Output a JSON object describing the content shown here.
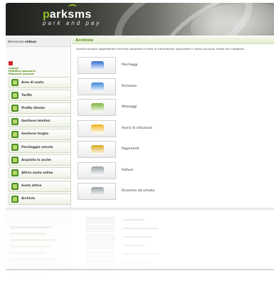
{
  "header": {
    "logo_p": "p",
    "logo_rest": "arksms",
    "tagline": "park and pay"
  },
  "sidebar": {
    "welcome_prefix": "Benvenuto ",
    "welcome_user": "nidiusr",
    "links": [
      "Logout",
      "Modifica password",
      "Riassumi account"
    ],
    "menu": [
      {
        "label": "Aree di sosta",
        "icon": "parking-area-icon"
      },
      {
        "label": "Tariffe",
        "icon": "tariff-icon"
      },
      {
        "label": "Profilo Utente",
        "icon": "user-profile-icon"
      },
      {
        "label": "Gestione telefoni",
        "icon": "phone-icon"
      },
      {
        "label": "Gestione targhe",
        "icon": "car-plate-icon"
      },
      {
        "label": "Parcheggia veicolo",
        "icon": "park-vehicle-icon"
      },
      {
        "label": "Acquista in anche",
        "icon": "cart-icon"
      },
      {
        "label": "Attiva sosta online",
        "icon": "activate-parking-icon"
      },
      {
        "label": "Sosta attive",
        "icon": "active-parking-icon"
      },
      {
        "label": "Archivio",
        "icon": "archive-folder-icon"
      }
    ]
  },
  "main": {
    "title": "Archivio",
    "intro": "Questa sezione rappresenta l'archivio completo di tutte le informazioni riguardanti il vostro account, divise per categoria.",
    "rows": [
      {
        "label": "Parcheggi",
        "icon": "car-icon",
        "color": "#2f6fd1"
      },
      {
        "label": "Richieste",
        "icon": "mobile-phone-icon",
        "color": "#3a88d8"
      },
      {
        "label": "Messaggi",
        "icon": "message-icon",
        "color": "#7fb33a"
      },
      {
        "label": "Avvisi di infrazione",
        "icon": "shield-warning-icon",
        "color": "#f0b21d"
      },
      {
        "label": "Pagamenti",
        "icon": "coins-icon",
        "color": "#d9a919"
      },
      {
        "label": "Fatture",
        "icon": "invoice-icon",
        "color": "#9aa3a6"
      },
      {
        "label": "Ricariche da scheda",
        "icon": "recharge-card-icon",
        "color": "#9aa3a6"
      }
    ]
  },
  "colors": {
    "accent_green": "#5a8c1a",
    "menu_icon_green": "#4e8f27",
    "logout_red": "#d6262a"
  }
}
